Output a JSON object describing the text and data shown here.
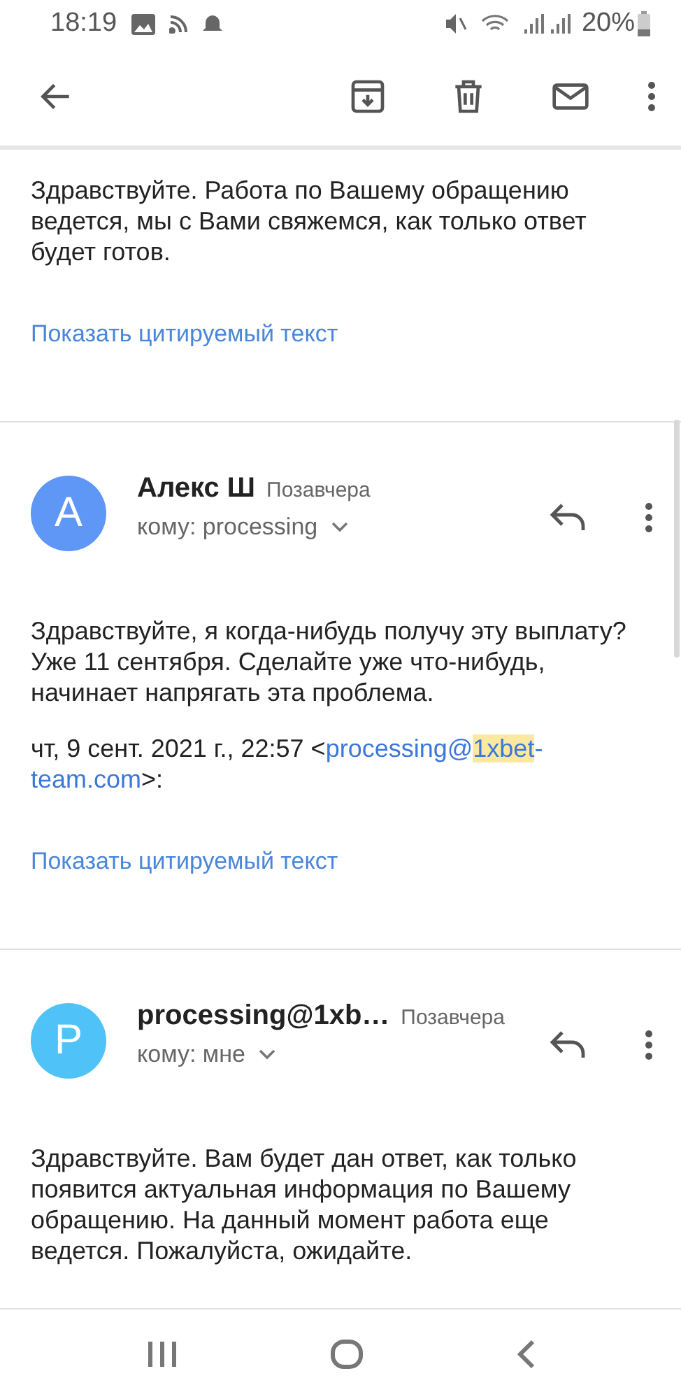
{
  "status_bar": {
    "time": "18:19",
    "battery": "20%"
  },
  "messages": [
    {
      "body": "Здравствуйте. Работа по Вашему обращению ведется, мы с Вами свяжемся, как только ответ будет готов.",
      "quote_link": "Показать цитируемый текст"
    },
    {
      "sender": "Алекс Ш",
      "time": "Позавчера",
      "recipient": "кому: processing",
      "avatar": {
        "letter": "A",
        "color": "#5e97f6"
      },
      "body": "Здравствуйте, я когда-нибудь получу эту выплату? Уже 11 сентября.  Сделайте уже что-нибудь, начинает напрягать эта проблема.",
      "quoted_header": {
        "prefix": "чт, 9 сент. 2021 г., 22:57 <",
        "address_lines": [
          {
            "parts": [
              {
                "text": "processing@",
                "highlighted": false
              },
              {
                "text": "1xbet",
                "highlighted": true
              },
              {
                "text": "-",
                "highlighted": false
              }
            ]
          },
          {
            "parts": [
              {
                "text": "team.com",
                "highlighted": false
              }
            ]
          }
        ],
        "suffix": ">:"
      },
      "quote_link": "Показать цитируемый текст"
    },
    {
      "sender": "processing@1xb…",
      "time": "Позавчера",
      "recipient": "кому: мне",
      "avatar": {
        "letter": "P",
        "color": "#4fc3f7"
      },
      "body": "Здравствуйте. Вам будет дан ответ, как только появится актуальная информация по Вашему обращению. На данный момент работа еще ведется. Пожалуйста, ожидайте."
    }
  ]
}
